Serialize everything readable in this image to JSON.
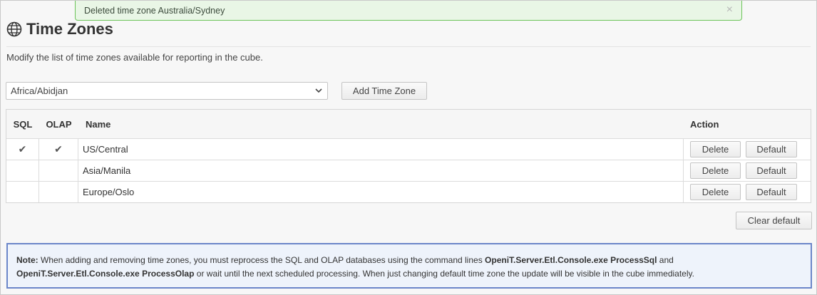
{
  "alert": {
    "message": "Deleted time zone Australia/Sydney",
    "close_glyph": "×"
  },
  "header": {
    "title": "Time Zones",
    "icon": "globe-icon"
  },
  "description": "Modify the list of time zones available for reporting in the cube.",
  "add_form": {
    "selected_time_zone": "Africa/Abidjan",
    "add_button_label": "Add Time Zone"
  },
  "table": {
    "columns": {
      "sql": "SQL",
      "olap": "OLAP",
      "name": "Name",
      "action": "Action"
    },
    "rows": [
      {
        "sql": "✔",
        "olap": "✔",
        "name": "US/Central",
        "delete_label": "Delete",
        "default_label": "Default"
      },
      {
        "sql": "",
        "olap": "",
        "name": "Asia/Manila",
        "delete_label": "Delete",
        "default_label": "Default"
      },
      {
        "sql": "",
        "olap": "",
        "name": "Europe/Oslo",
        "delete_label": "Delete",
        "default_label": "Default"
      }
    ]
  },
  "clear_default_label": "Clear default",
  "note": {
    "label": "Note:",
    "text1": " When adding and removing time zones, you must reprocess the SQL and OLAP databases using the command lines ",
    "cmd1": "OpeniT.Server.Etl.Console.exe ProcessSql",
    "text2": " and ",
    "cmd2": "OpeniT.Server.Etl.Console.exe ProcessOlap",
    "text3": " or wait until the next scheduled processing. When just changing default time zone the update will be visible in the cube immediately."
  },
  "colors": {
    "success_border": "#6cc45a",
    "success_bg": "#e9f6e6",
    "note_border": "#6b86c9",
    "note_bg": "#eef3fb"
  }
}
